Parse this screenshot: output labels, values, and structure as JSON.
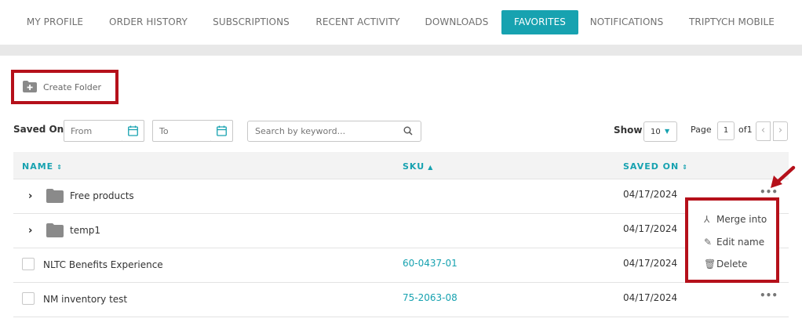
{
  "tabs": [
    {
      "label": "MY PROFILE"
    },
    {
      "label": "ORDER HISTORY"
    },
    {
      "label": "SUBSCRIPTIONS"
    },
    {
      "label": "RECENT ACTIVITY"
    },
    {
      "label": "DOWNLOADS"
    },
    {
      "label": "FAVORITES",
      "active": true
    },
    {
      "label": "NOTIFICATIONS"
    },
    {
      "label": "TRIPTYCH MOBILE"
    }
  ],
  "toolbar": {
    "create_folder_label": "Create Folder",
    "create_folder_icon": "folder-plus-icon"
  },
  "filters": {
    "saved_on_label": "Saved On",
    "from_placeholder": "From",
    "to_placeholder": "To",
    "calendar_icon": "calendar-icon",
    "search_placeholder": "Search by keyword...",
    "search_icon": "search-icon"
  },
  "pagination": {
    "show_label": "Show",
    "page_size": "10",
    "page_label": "Page",
    "current_page": "1",
    "of_label": "of1",
    "prev_symbol": "‹",
    "next_symbol": "›"
  },
  "table": {
    "columns": {
      "name": "NAME",
      "sku": "SKU",
      "saved_on": "SAVED ON"
    },
    "rows": [
      {
        "type": "folder",
        "name": "Free products",
        "sku": "",
        "saved_on": "04/17/2024",
        "more": "•••"
      },
      {
        "type": "folder",
        "name": "temp1",
        "sku": "",
        "saved_on": "04/17/2024",
        "more": ""
      },
      {
        "type": "item",
        "name": "NLTC Benefits Experience",
        "sku": "60-0437-01",
        "saved_on": "04/17/2024",
        "more": ""
      },
      {
        "type": "item",
        "name": "NM inventory test",
        "sku": "75-2063-08",
        "saved_on": "04/17/2024",
        "more": "•••"
      }
    ]
  },
  "row_menu": {
    "items": [
      {
        "label": "Merge into",
        "icon": "merge-icon"
      },
      {
        "label": "Edit name",
        "icon": "pencil-icon"
      },
      {
        "label": "Delete",
        "icon": "trash-icon"
      }
    ]
  },
  "colors": {
    "accent": "#17a2b0",
    "highlight_border": "#b5101a",
    "annotation_arrow": "#b5101a"
  }
}
